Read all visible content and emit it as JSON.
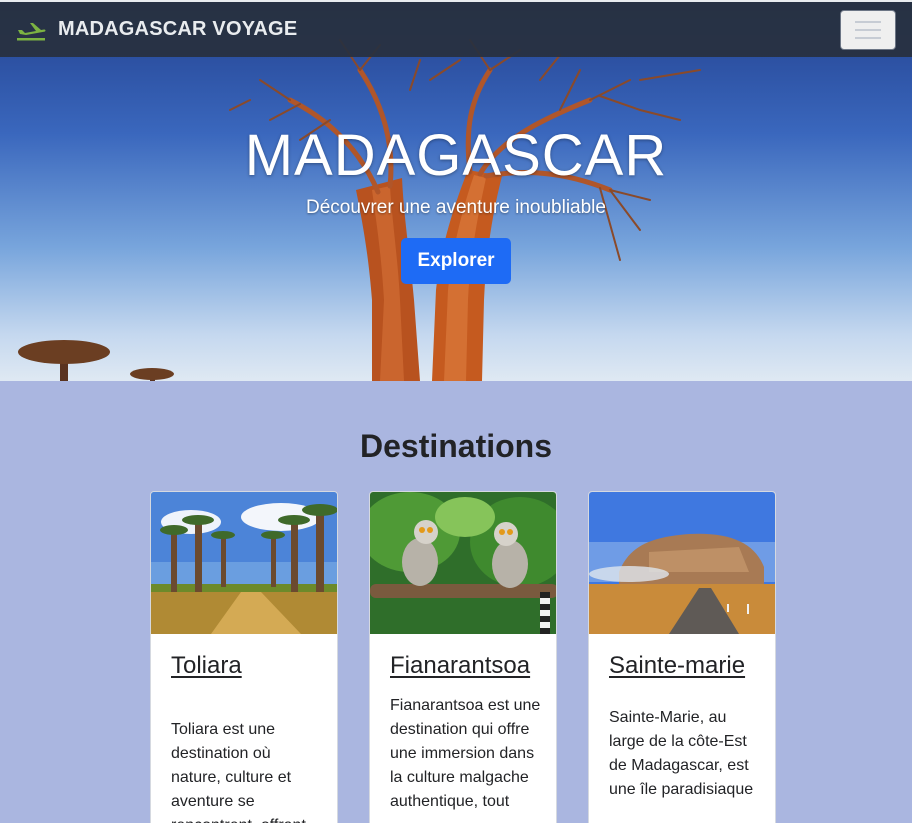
{
  "navbar": {
    "brand": "MADAGASCAR VOYAGE",
    "brand_icon": "airplane-icon",
    "toggler_icon": "hamburger-menu-icon"
  },
  "hero": {
    "title": "MADAGASCAR",
    "subtitle": "Découvrer une aventure inoubliable",
    "button": "Explorer",
    "button_color": "#1e6bf5"
  },
  "destinations": {
    "heading": "Destinations",
    "cards": [
      {
        "title": "Toliara",
        "text": "Toliara est une destination où nature, culture et aventure se rencontrent, offrant"
      },
      {
        "title": "Fianarantsoa",
        "text": "Fianarantsoa est une destination qui offre une immersion dans la culture malgache authentique, tout"
      },
      {
        "title": "Sainte-marie",
        "text": "Sainte-Marie, au large de la côte-Est de Madagascar, est une île paradisiaque"
      }
    ]
  },
  "colors": {
    "navbar_bg": "#28303e",
    "page_bg": "#aab6e0",
    "accent": "#1e6bf5"
  }
}
